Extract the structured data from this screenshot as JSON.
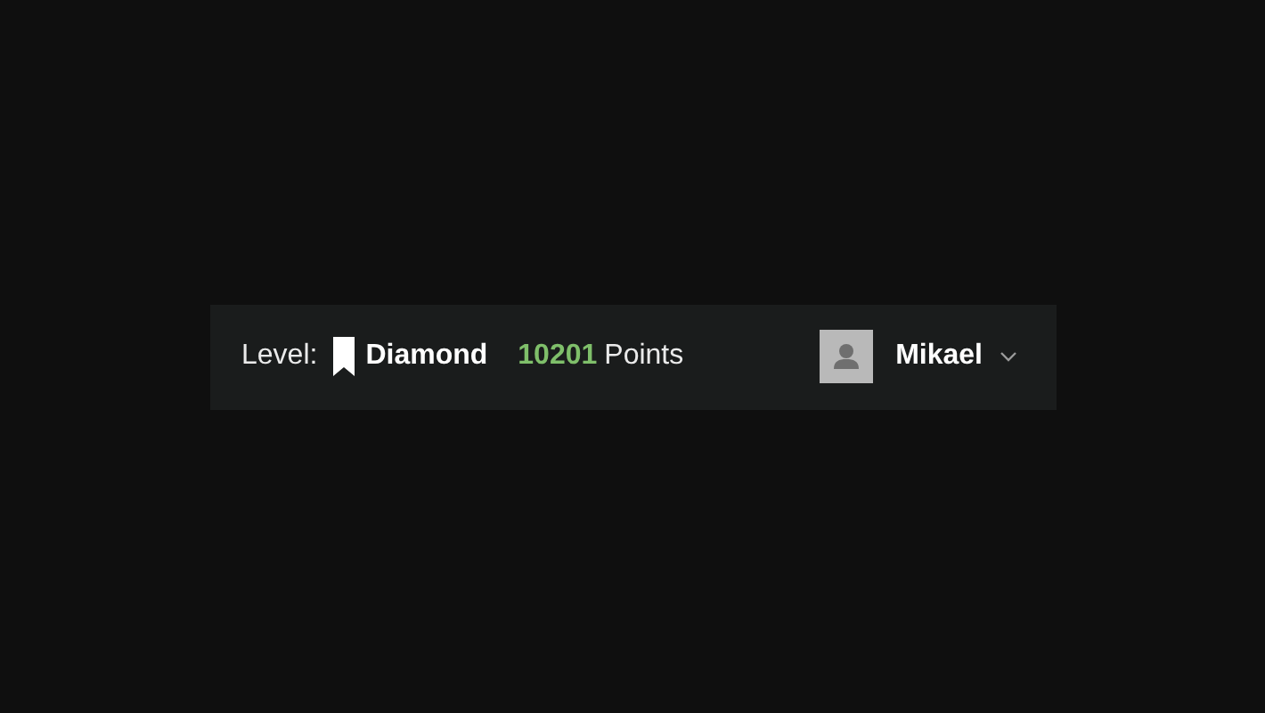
{
  "level": {
    "label": "Level:",
    "name": "Diamond"
  },
  "points": {
    "value": "10201",
    "label": "Points"
  },
  "user": {
    "name": "Mikael"
  }
}
